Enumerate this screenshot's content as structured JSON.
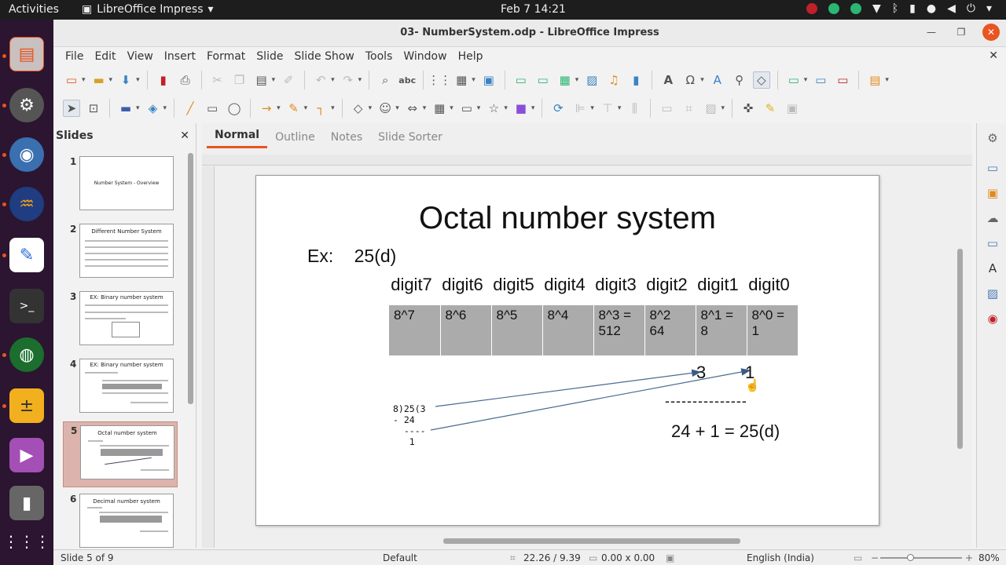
{
  "topbar": {
    "activities": "Activities",
    "app_name": "LibreOffice Impress",
    "clock": "Feb 7  14:21"
  },
  "window": {
    "title": "03- NumberSystem.odp - LibreOffice Impress"
  },
  "menu": [
    "File",
    "Edit",
    "View",
    "Insert",
    "Format",
    "Slide",
    "Slide Show",
    "Tools",
    "Window",
    "Help"
  ],
  "slides_pane": {
    "header": "Slides",
    "thumbs": [
      {
        "num": "1",
        "title": "Number System - Overview"
      },
      {
        "num": "2",
        "title": "Different Number System"
      },
      {
        "num": "3",
        "title": "EX: Binary number system"
      },
      {
        "num": "4",
        "title": "EX: Binary number system"
      },
      {
        "num": "5",
        "title": "Octal number system"
      },
      {
        "num": "6",
        "title": "Decimal number system"
      }
    ]
  },
  "view_tabs": [
    "Normal",
    "Outline",
    "Notes",
    "Slide Sorter"
  ],
  "slide": {
    "title": "Octal number system",
    "ex_label": "Ex:",
    "ex_value": "25(d)",
    "digits": [
      "digit7",
      "digit6",
      "digit5",
      "digit4",
      "digit3",
      "digit2",
      "digit1",
      "digit0"
    ],
    "powers": [
      [
        "8^7"
      ],
      [
        "8^6"
      ],
      [
        "8^5"
      ],
      [
        "8^4"
      ],
      [
        "8^3 =",
        "512"
      ],
      [
        "8^2",
        "64"
      ],
      [
        "8^1 =",
        "8"
      ],
      [
        "8^0 =",
        "1"
      ]
    ],
    "result_digit_1": "3",
    "result_digit_0": "1",
    "dashes": "---------------",
    "sum": "24 + 1 =   25(d)",
    "work_lines": [
      "8)25(3",
      "- 24",
      "  ----",
      "   1"
    ]
  },
  "statusbar": {
    "slide_info": "Slide 5 of 9",
    "layout": "Default",
    "position": "22.26 / 9.39",
    "size": "0.00 x 0.00",
    "language": "English (India)",
    "zoom": "80%"
  }
}
